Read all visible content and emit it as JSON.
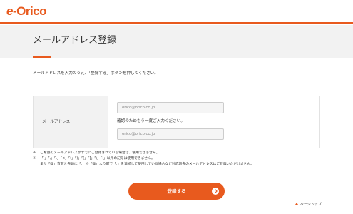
{
  "header": {
    "logo_e": "e",
    "logo_dash": "-",
    "logo_rest": "Orico"
  },
  "page": {
    "title": "メールアドレス登録",
    "instruction": "メールアドレスを入力のうえ、「登録する」ボタンを押してください。"
  },
  "form": {
    "label": "メールアドレス",
    "email_placeholder": "orico@orico.co.jp",
    "confirm_label": "確認のためもう一度ご入力ください。",
    "confirm_placeholder": "orico@orico.co.jp"
  },
  "notes": {
    "mark": "※",
    "note1": "ご希望のメールアドレスがすでにご登録されている場合は、使用できません。",
    "note2": "「;」「,」「.」「<」「(」「)」「[」「]」「\\」「:」以外の記号は使用できません。",
    "note3": "また「@」直前と先頭に「.」や「@」より前で「.」を連続して使用している場合など対応過去のメールアドレスはご登録いただけません。"
  },
  "actions": {
    "register_label": "登録する",
    "page_top_label": "ページトップ"
  },
  "colors": {
    "accent": "#e85a1e",
    "band": "#f2f2f2"
  },
  "icons": {
    "register_arrow": "chevron-right-circle-icon",
    "page_top": "caret-up-icon"
  }
}
